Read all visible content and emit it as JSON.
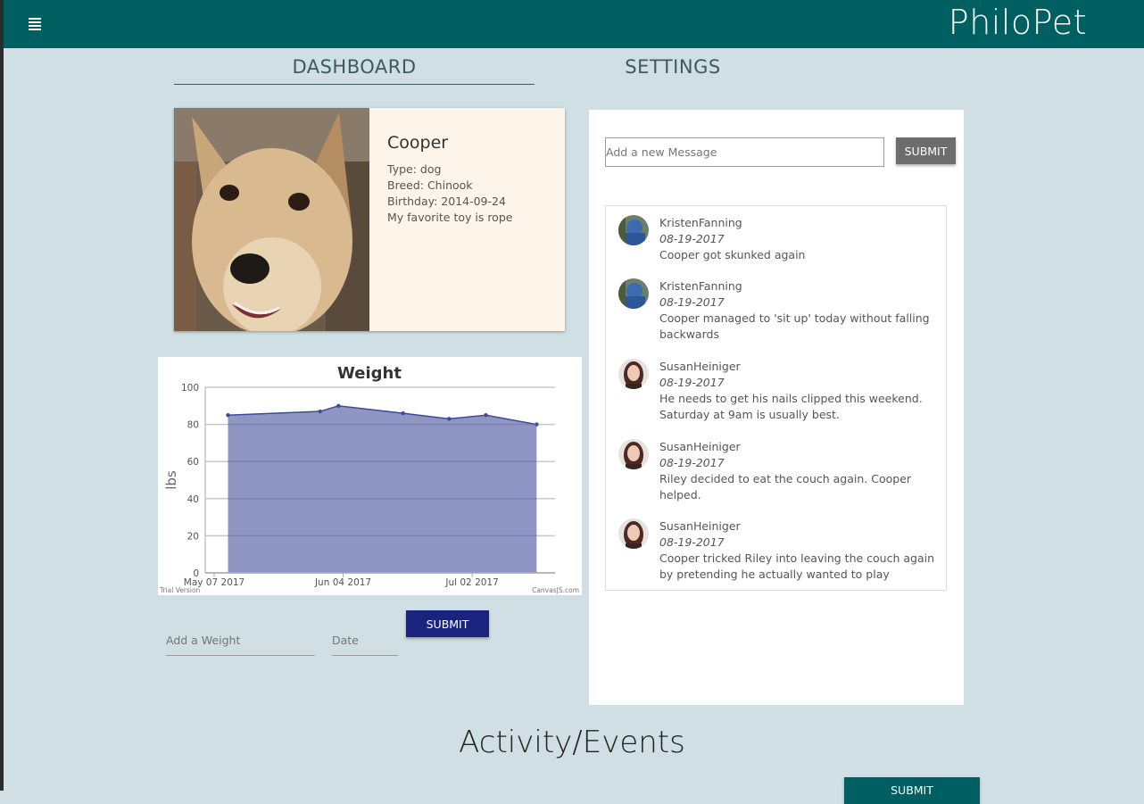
{
  "app": {
    "brand": "PhiloPet"
  },
  "tabs": [
    {
      "label": "DASHBOARD"
    },
    {
      "label": "SETTINGS"
    }
  ],
  "pet": {
    "name": "Cooper",
    "type": "Type: dog",
    "breed": "Breed: Chinook",
    "birthday": "Birthday: 2014-09-24",
    "toy": "My favorite toy is rope"
  },
  "weight_form": {
    "weight_placeholder": "Add a Weight",
    "date_placeholder": "Date",
    "submit_label": "SUBMIT"
  },
  "chart_data": {
    "type": "area",
    "title": "Weight",
    "ylabel": "lbs",
    "xlabel": "",
    "ylim": [
      0,
      100
    ],
    "yticks": [
      0,
      20,
      40,
      60,
      80,
      100
    ],
    "xticks": [
      {
        "label": "May 07 2017",
        "date": "2017-05-07"
      },
      {
        "label": "Jun 04 2017",
        "date": "2017-06-04"
      },
      {
        "label": "Jul 02 2017",
        "date": "2017-07-02"
      }
    ],
    "xlim": [
      "2017-05-07",
      "2017-07-20"
    ],
    "points": [
      {
        "date": "2017-05-10",
        "value": 85
      },
      {
        "date": "2017-05-30",
        "value": 87
      },
      {
        "date": "2017-06-03",
        "value": 90
      },
      {
        "date": "2017-06-17",
        "value": 86
      },
      {
        "date": "2017-06-27",
        "value": 83
      },
      {
        "date": "2017-07-05",
        "value": 85
      },
      {
        "date": "2017-07-16",
        "value": 80
      }
    ],
    "grid": true,
    "fill_color": "#8a90c0",
    "line_color": "#3f4a94",
    "watermark_left": "Trial Version",
    "watermark_right": "CanvasJS.com"
  },
  "messages": {
    "input_placeholder": "Add a new Message",
    "submit_label": "SUBMIT",
    "items": [
      {
        "user": "KristenFanning",
        "date": "08-19-2017",
        "text": "Cooper got skunked again",
        "avatar": "kristen"
      },
      {
        "user": "KristenFanning",
        "date": "08-19-2017",
        "text": "Cooper managed to 'sit up' today without falling backwards",
        "avatar": "kristen"
      },
      {
        "user": "SusanHeiniger",
        "date": "08-19-2017",
        "text": "He needs to get his nails clipped this weekend. Saturday at 9am is usually best.",
        "avatar": "susan"
      },
      {
        "user": "SusanHeiniger",
        "date": "08-19-2017",
        "text": "Riley decided to eat the couch again. Cooper helped.",
        "avatar": "susan"
      },
      {
        "user": "SusanHeiniger",
        "date": "08-19-2017",
        "text": "Cooper tricked Riley into leaving the couch again by pretending he actually wanted to play",
        "avatar": "susan"
      }
    ]
  },
  "events": {
    "title": "Activity/Events",
    "submit_label": "SUBMIT"
  },
  "colors": {
    "header": "#005f60",
    "background": "#cfdfe4",
    "navy_button": "#1a237e",
    "grey_button": "#6d6d6d"
  }
}
